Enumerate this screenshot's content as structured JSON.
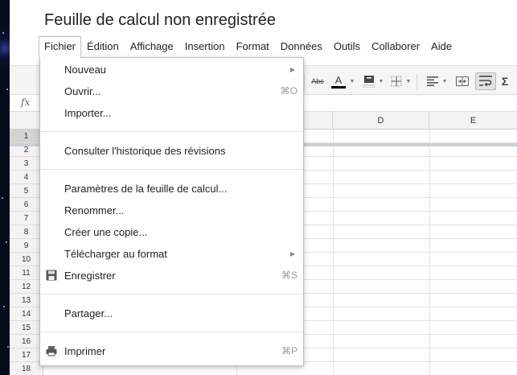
{
  "window": {
    "title": "Feuille de calcul non enregistrée"
  },
  "menubar": {
    "items": [
      {
        "label": "Fichier",
        "active": true
      },
      {
        "label": "Édition"
      },
      {
        "label": "Affichage"
      },
      {
        "label": "Insertion"
      },
      {
        "label": "Format"
      },
      {
        "label": "Données"
      },
      {
        "label": "Outils"
      },
      {
        "label": "Collaborer"
      },
      {
        "label": "Aide"
      }
    ]
  },
  "toolbar": {
    "strikethrough_label": "Abc",
    "text_color_label": "A",
    "sum_label": "Σ",
    "text_color": "#000000"
  },
  "formula_bar": {
    "fx_label": "fx"
  },
  "grid": {
    "columns": [
      "D",
      "E"
    ],
    "rows": [
      "1",
      "2",
      "3",
      "4",
      "5",
      "6",
      "7",
      "8",
      "9",
      "10",
      "11",
      "12",
      "13",
      "14",
      "15",
      "16",
      "17",
      "18"
    ],
    "selected_row": "1"
  },
  "file_menu": {
    "new": {
      "label": "Nouveau",
      "icon": "submenu-arrow-icon"
    },
    "open": {
      "label": "Ouvrir...",
      "shortcut": "⌘O"
    },
    "import": {
      "label": "Importer..."
    },
    "history": {
      "label": "Consulter l'historique des révisions"
    },
    "settings": {
      "label": "Paramètres de la feuille de calcul..."
    },
    "rename": {
      "label": "Renommer..."
    },
    "copy": {
      "label": "Créer une copie..."
    },
    "download": {
      "label": "Télécharger au format",
      "icon": "submenu-arrow-icon"
    },
    "save": {
      "label": "Enregistrer",
      "shortcut": "⌘S",
      "icon": "floppy-disk-icon"
    },
    "share": {
      "label": "Partager..."
    },
    "print": {
      "label": "Imprimer",
      "shortcut": "⌘P",
      "icon": "printer-icon"
    }
  },
  "colors": {
    "menu_border": "#bdbdbd",
    "toolbar_bg": "#f5f5f5",
    "header_bg": "#f3f3f3",
    "selected_row_header": "#d3d3d3"
  }
}
